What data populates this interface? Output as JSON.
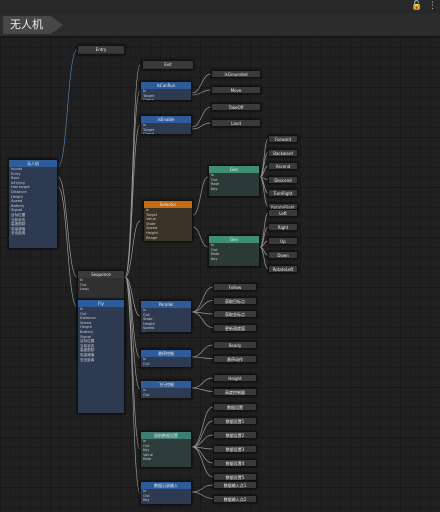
{
  "header": {
    "breadcrumb": "无人机",
    "lock_icon": "lock-icon",
    "menu_icon": "more-vertical-icon"
  },
  "colors": {
    "canvas": "#202020",
    "node_blue": "#2e5b99",
    "node_orange": "#c46a12",
    "node_green": "#3f8f73",
    "wire": "#9a9a9a",
    "wire_blue": "#4f7fae"
  },
  "nodes": {
    "entry": {
      "title": "Entry"
    },
    "root": {
      "title": "无人机",
      "rows": [
        "Inputs",
        "Entry",
        "Root",
        "IsFlying",
        "Has target",
        "Distance",
        "Height",
        "Speed",
        "Battery",
        "Signal",
        "目标位置",
        "当前状态",
        "高度限制",
        "电量阈值",
        "安全距离"
      ]
    },
    "loop": {
      "title": "Sequence",
      "rows": [
        "In",
        "Out",
        "Loop"
      ]
    },
    "exit": {
      "title": "Exit"
    },
    "check_a": {
      "title": "IsCanRun",
      "rows": [
        "In",
        "Target",
        "Check"
      ]
    },
    "check_b": {
      "title": "IsEnable",
      "rows": [
        "In",
        "Target",
        "Check"
      ]
    },
    "leaf_a1": {
      "title": "IsGrounded"
    },
    "leaf_a2": {
      "title": "Move"
    },
    "leaf_b1": {
      "title": "TakeOff"
    },
    "leaf_b2": {
      "title": "Land"
    },
    "selector": {
      "title": "Selector",
      "rows": [
        "In",
        "Target",
        "Value",
        "State",
        "Speed",
        "Height",
        "Range"
      ]
    },
    "gen_top": {
      "title": "Gen",
      "rows": [
        "In",
        "Out",
        "Rate",
        "Key"
      ]
    },
    "gen_bot": {
      "title": "Gen",
      "rows": [
        "In",
        "Out",
        "Rate",
        "Key"
      ]
    },
    "moves_top": [
      "Forward",
      "Backward",
      "Ascend",
      "Descend",
      "TurnRight",
      "RotateRight"
    ],
    "moves_bot": [
      "Left",
      "Right",
      "Up",
      "Down",
      "RotateLeft"
    ],
    "parallel": {
      "title": "Parallel",
      "rows": [
        "In",
        "Out",
        "State",
        "Height",
        "Speed",
        "Range",
        "Check"
      ]
    },
    "fly": {
      "title": "Fly",
      "rows": [
        "In",
        "Out",
        "Distance",
        "Speed",
        "Height",
        "Battery",
        "Signal",
        "目标位置",
        "当前状态",
        "高度限制",
        "电量阈值",
        "安全距离"
      ]
    },
    "detect": {
      "title": "Detection",
      "rows": [
        "In",
        "Out",
        "Range"
      ]
    },
    "hover": {
      "title": "悬停控制",
      "rows": [
        "In",
        "Out",
        "Value"
      ]
    },
    "climb": {
      "title": "飞行控制",
      "rows": [
        "In",
        "Out",
        "Value"
      ]
    },
    "scan": {
      "title": "巡航数据设置",
      "rows": [
        "In",
        "Out",
        "Key",
        "Value",
        "Rate"
      ]
    },
    "record": {
      "title": "数据记录输入",
      "rows": [
        "In",
        "Out",
        "Key"
      ]
    },
    "actions_parallel": [
      "Follow",
      "获取目标点",
      "获取坐标点",
      "更新速度值"
    ],
    "actions_hover": [
      "Ready",
      "悬停动作"
    ],
    "actions_climb": [
      "Height",
      "高度控制器"
    ],
    "actions_scan": [
      "数据设置",
      "数据设置1",
      "数据设置2",
      "数据设置3",
      "数据设置4",
      "数据设置5"
    ],
    "actions_record": [
      "数据输入点1",
      "数据输入点2"
    ]
  }
}
